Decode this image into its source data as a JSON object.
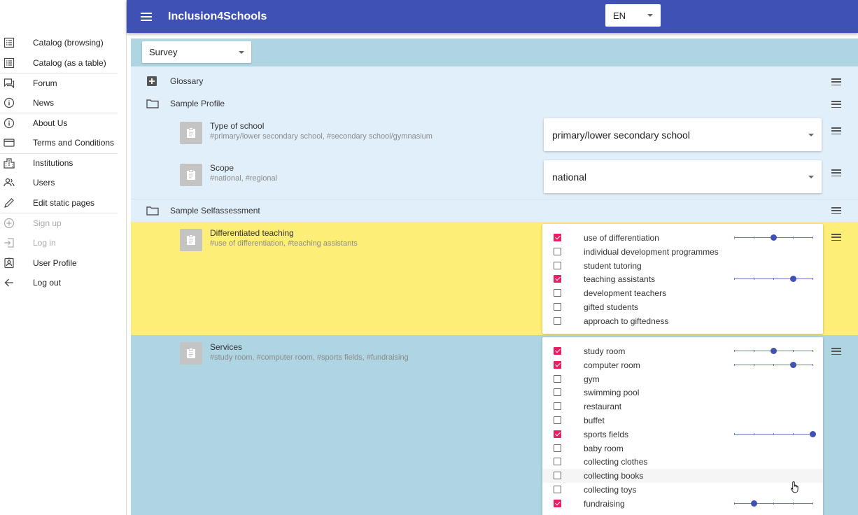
{
  "header": {
    "app_title": "Inclusion4Schools",
    "language": "EN"
  },
  "sidebar": {
    "items": [
      {
        "label": "Catalog (browsing)",
        "icon": "list-icon"
      },
      {
        "label": "Catalog (as a table)",
        "icon": "list-icon"
      },
      {
        "label": "Forum",
        "icon": "forum-icon"
      },
      {
        "label": "News",
        "icon": "info-icon"
      },
      {
        "label": "About Us",
        "icon": "info-icon"
      },
      {
        "label": "Terms and Conditions",
        "icon": "card-icon"
      },
      {
        "label": "Institutions",
        "icon": "building-icon"
      },
      {
        "label": "Users",
        "icon": "users-icon"
      },
      {
        "label": "Edit static pages",
        "icon": "pencil-icon"
      },
      {
        "label": "Sign up",
        "icon": "add-circle-icon"
      },
      {
        "label": "Log in",
        "icon": "login-icon"
      },
      {
        "label": "User Profile",
        "icon": "profile-icon"
      },
      {
        "label": "Log out",
        "icon": "arrow-left-icon"
      }
    ]
  },
  "main": {
    "survey_select": "Survey",
    "glossary_label": "Glossary",
    "sample_profile": {
      "label": "Sample Profile",
      "items": [
        {
          "title": "Type of school",
          "tags": "#primary/lower secondary school, #secondary school/gymnasium",
          "value": "primary/lower secondary school"
        },
        {
          "title": "Scope",
          "tags": "#national, #regional",
          "value": "national"
        }
      ]
    },
    "sample_selfassessment": {
      "label": "Sample Selfassessment",
      "differentiated_teaching": {
        "title": "Differentiated teaching",
        "tags": "#use of differentiation, #teaching assistants",
        "options": [
          {
            "label": "use of differentiation",
            "checked": true,
            "level": 2
          },
          {
            "label": "individual development programmes",
            "checked": false
          },
          {
            "label": "student tutoring",
            "checked": false
          },
          {
            "label": "teaching assistants",
            "checked": true,
            "level": 3
          },
          {
            "label": "development teachers",
            "checked": false
          },
          {
            "label": "gifted students",
            "checked": false
          },
          {
            "label": "approach to giftedness",
            "checked": false
          }
        ]
      },
      "services": {
        "title": "Services",
        "tags": "#study room, #computer room, #sports fields, #fundraising",
        "options": [
          {
            "label": "study room",
            "checked": true,
            "level": 2
          },
          {
            "label": "computer room",
            "checked": true,
            "level": 3
          },
          {
            "label": "gym",
            "checked": false
          },
          {
            "label": "swimming pool",
            "checked": false
          },
          {
            "label": "restaurant",
            "checked": false
          },
          {
            "label": "buffet",
            "checked": false
          },
          {
            "label": "sports fields",
            "checked": true,
            "level": 4
          },
          {
            "label": "baby room",
            "checked": false
          },
          {
            "label": "collecting clothes",
            "checked": false
          },
          {
            "label": "collecting books",
            "checked": false
          },
          {
            "label": "collecting toys",
            "checked": false
          },
          {
            "label": "fundraising",
            "checked": true,
            "level": 1
          }
        ]
      }
    }
  },
  "colors": {
    "appbar": "#3f51b5",
    "checkbox_checked": "#e91e63",
    "yellow_section": "#fdee77",
    "blue_section": "#afd5e3",
    "light_section": "#e1effb"
  }
}
